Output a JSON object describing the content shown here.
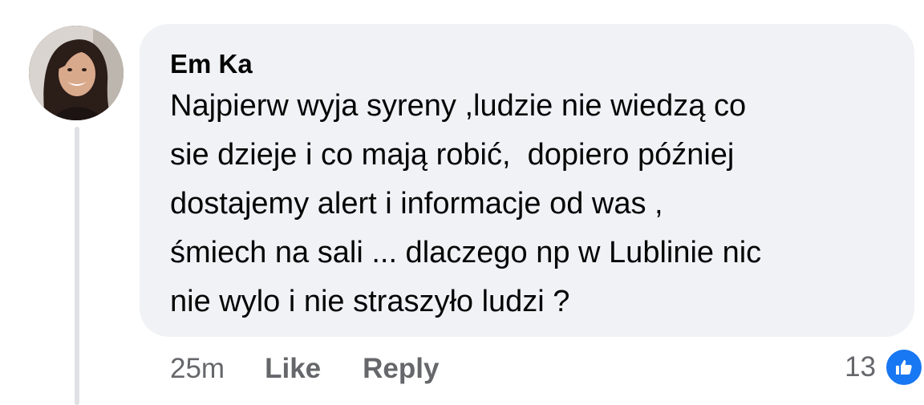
{
  "comment": {
    "author": "Em Ka",
    "text_lines": [
      "Najpierw wyja syreny ,ludzie nie wiedzą co",
      "sie dzieje i co mają robić,  dopiero później",
      "dostajemy alert i informacje od was ,",
      "śmiech na sali ... dlaczego np w Lublinie nic",
      "nie wylo i nie straszyło ludzi ?"
    ],
    "timestamp": "25m",
    "like_label": "Like",
    "reply_label": "Reply",
    "reaction_count": "13",
    "reaction_icon": "thumbs-up-icon",
    "accent_color": "#1877f2"
  }
}
